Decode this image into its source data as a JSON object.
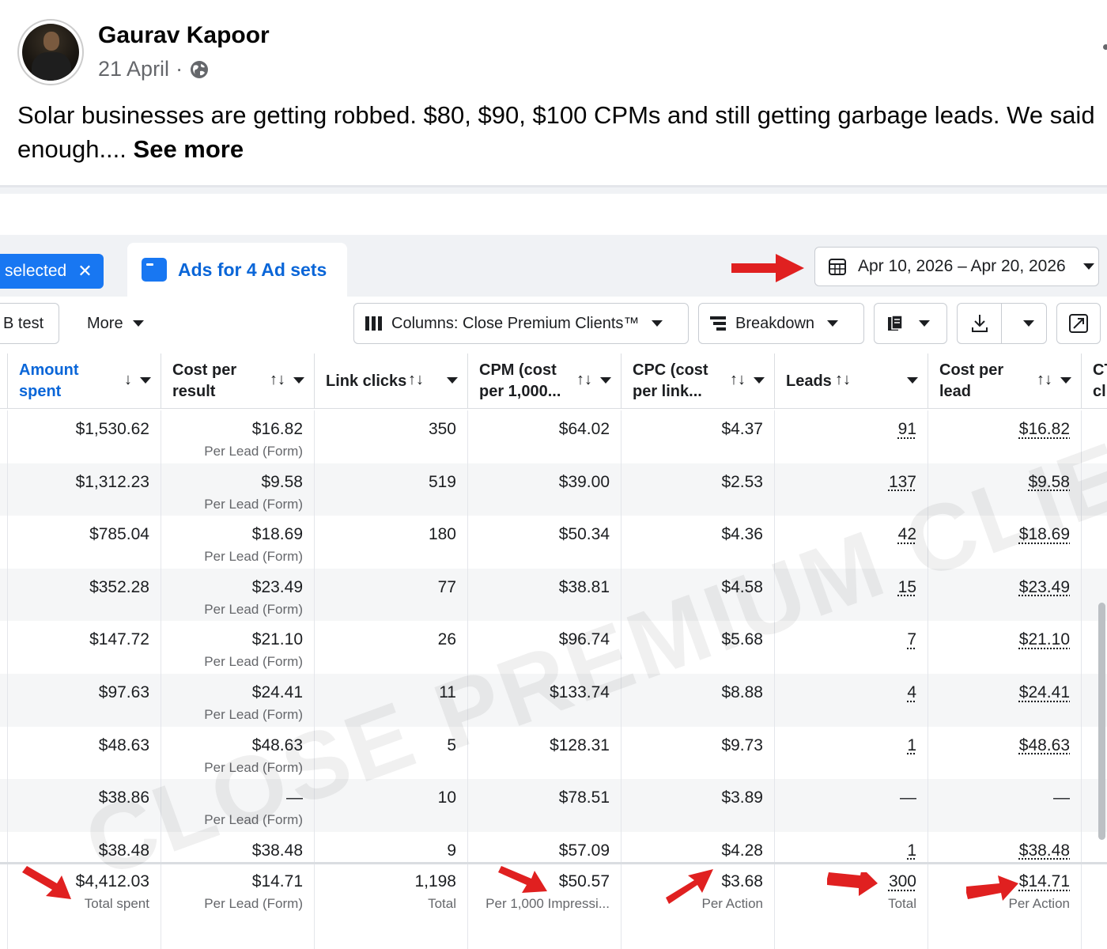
{
  "post": {
    "author": "Gaurav Kapoor",
    "date": "21 April",
    "separator": "·",
    "text": "Solar businesses are getting robbed. $80, $90, $100 CPMs and still getting garbage leads. We said enough....",
    "see_more": "See more"
  },
  "ads": {
    "selected_tab": "selected",
    "selected_close": "✕",
    "ads_tab": "Ads for 4 Ad sets",
    "date_range": "Apr 10, 2026 – Apr 20, 2026",
    "toolbar": {
      "ab_test": "B test",
      "more": "More",
      "columns": "Columns: Close Premium Clients™",
      "breakdown": "Breakdown"
    },
    "headers": [
      {
        "line1": "Amount",
        "line2": "spent",
        "sort": "↓"
      },
      {
        "line1": "Cost per",
        "line2": "result",
        "sort": "↑↓"
      },
      {
        "line1": "Link clicks",
        "sort": "↑↓"
      },
      {
        "line1": "CPM (cost",
        "line2": "per 1,000...",
        "sort": "↑↓"
      },
      {
        "line1": "CPC (cost",
        "line2": "per link...",
        "sort": "↑↓"
      },
      {
        "line1": "Leads",
        "sort": "↑↓"
      },
      {
        "line1": "Cost per",
        "line2": "lead",
        "sort": "↑↓"
      },
      {
        "line1": "CT",
        "line2": "cl"
      }
    ],
    "rows": [
      {
        "spent": "$1,530.62",
        "cpr": "$16.82",
        "cpr_sub": "Per Lead (Form)",
        "clicks": "350",
        "cpm": "$64.02",
        "cpc": "$4.37",
        "leads": "91",
        "cpl": "$16.82"
      },
      {
        "spent": "$1,312.23",
        "cpr": "$9.58",
        "cpr_sub": "Per Lead (Form)",
        "clicks": "519",
        "cpm": "$39.00",
        "cpc": "$2.53",
        "leads": "137",
        "cpl": "$9.58"
      },
      {
        "spent": "$785.04",
        "cpr": "$18.69",
        "cpr_sub": "Per Lead (Form)",
        "clicks": "180",
        "cpm": "$50.34",
        "cpc": "$4.36",
        "leads": "42",
        "cpl": "$18.69"
      },
      {
        "spent": "$352.28",
        "cpr": "$23.49",
        "cpr_sub": "Per Lead (Form)",
        "clicks": "77",
        "cpm": "$38.81",
        "cpc": "$4.58",
        "leads": "15",
        "cpl": "$23.49"
      },
      {
        "spent": "$147.72",
        "cpr": "$21.10",
        "cpr_sub": "Per Lead (Form)",
        "clicks": "26",
        "cpm": "$96.74",
        "cpc": "$5.68",
        "leads": "7",
        "cpl": "$21.10"
      },
      {
        "spent": "$97.63",
        "cpr": "$24.41",
        "cpr_sub": "Per Lead (Form)",
        "clicks": "11",
        "cpm": "$133.74",
        "cpc": "$8.88",
        "leads": "4",
        "cpl": "$24.41"
      },
      {
        "spent": "$48.63",
        "cpr": "$48.63",
        "cpr_sub": "Per Lead (Form)",
        "clicks": "5",
        "cpm": "$128.31",
        "cpc": "$9.73",
        "leads": "1",
        "cpl": "$48.63"
      },
      {
        "spent": "$38.86",
        "cpr": "—",
        "cpr_sub": "Per Lead (Form)",
        "clicks": "10",
        "cpm": "$78.51",
        "cpc": "$3.89",
        "leads": "—",
        "cpl": "—"
      },
      {
        "spent": "$38.48",
        "cpr": "$38.48",
        "cpr_sub": "",
        "clicks": "9",
        "cpm": "$57.09",
        "cpc": "$4.28",
        "leads": "1",
        "cpl": "$38.48"
      }
    ],
    "totals": {
      "spent": "$4,412.03",
      "spent_sub": "Total spent",
      "cpr": "$14.71",
      "cpr_sub": "Per Lead (Form)",
      "clicks": "1,198",
      "clicks_sub": "Total",
      "cpm": "$50.57",
      "cpm_sub": "Per 1,000 Impressi...",
      "cpc": "$3.68",
      "cpc_sub": "Per Action",
      "leads": "300",
      "leads_sub": "Total",
      "cpl": "$14.71",
      "cpl_sub": "Per Action"
    },
    "watermark": "CLOSE PREMIUM CLIENTS",
    "colors": {
      "accent": "#1877f2",
      "link": "#0a66d8",
      "arrow": "#e02020"
    }
  }
}
